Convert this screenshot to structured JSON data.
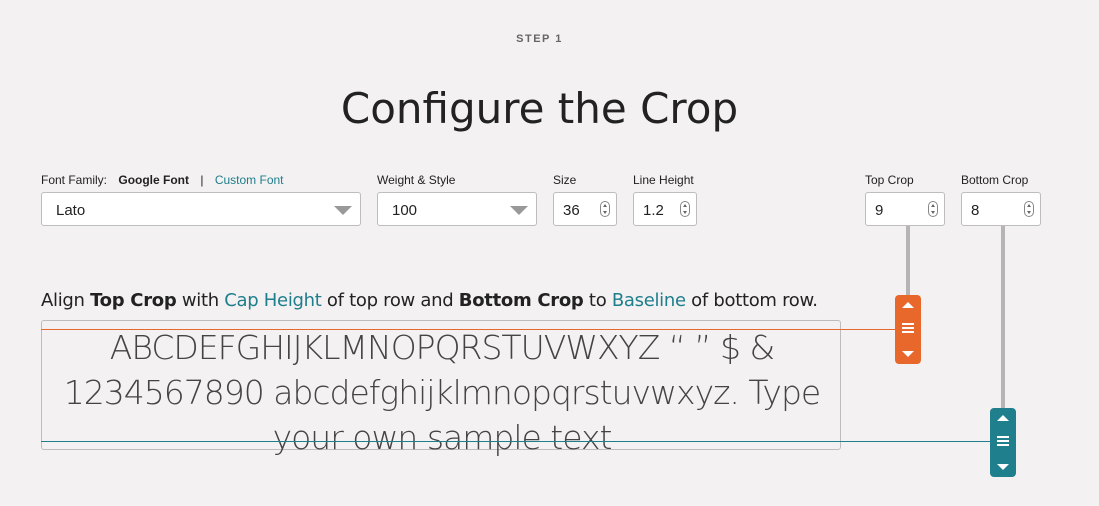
{
  "header": {
    "step": "STEP 1",
    "title": "Configure the Crop"
  },
  "controls": {
    "font_family_label": "Font Family:",
    "google_font_label": "Google Font",
    "separator": "|",
    "custom_font_label": "Custom Font",
    "font_family_value": "Lato",
    "weight_style_label": "Weight & Style",
    "weight_style_value": "100",
    "size_label": "Size",
    "size_value": "36",
    "line_height_label": "Line Height",
    "line_height_value": "1.2",
    "top_crop_label": "Top Crop",
    "top_crop_value": "9",
    "bottom_crop_label": "Bottom Crop",
    "bottom_crop_value": "8"
  },
  "instruction": {
    "part1": "Align ",
    "top_crop": "Top Crop",
    "part2": " with ",
    "cap_height": "Cap Height",
    "part3": " of top row and ",
    "bottom_crop": "Bottom Crop",
    "part4": " to ",
    "baseline": "Baseline",
    "part5": " of bottom row."
  },
  "sample": {
    "text": "ABCDEFGHIJKLMNOPQRSTUVWXYZ “ ” $ & 1234567890 abcdefghijklmnopqrstuvwxyz. Type your own sample text"
  },
  "colors": {
    "top_crop_accent": "#e8672a",
    "bottom_crop_accent": "#1f7f8d",
    "link": "#1e7e8c"
  },
  "icons": {
    "select_arrow": "triangle-down-icon",
    "spinner": "spinner-icon",
    "handle_grip": "drag-handle-icon"
  }
}
